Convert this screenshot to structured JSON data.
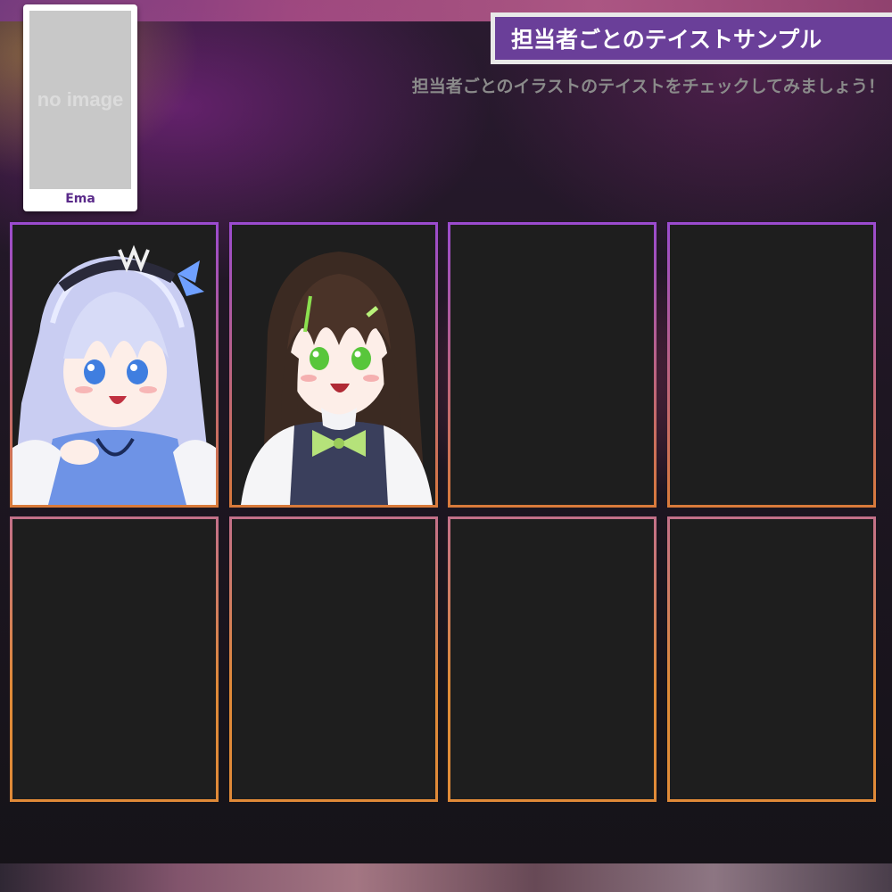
{
  "profile": {
    "placeholder_text": "no image",
    "name": "Ema"
  },
  "header": {
    "title": "担当者ごとのテイストサンプル",
    "subtitle": "担当者ごとのイラストのテイストをチェックしてみましょう！"
  },
  "gallery": {
    "tiles": [
      {
        "status": "filled",
        "image": "silver-haired-girl-illustration"
      },
      {
        "status": "filled",
        "image": "brown-haired-girl-illustration"
      },
      {
        "status": "empty"
      },
      {
        "status": "empty"
      },
      {
        "status": "empty"
      },
      {
        "status": "empty"
      },
      {
        "status": "empty"
      },
      {
        "status": "empty"
      }
    ]
  },
  "colors": {
    "accent": "#6a3f99",
    "frame_top": "#9b4bd0",
    "frame_bottom": "#d97a3a"
  }
}
